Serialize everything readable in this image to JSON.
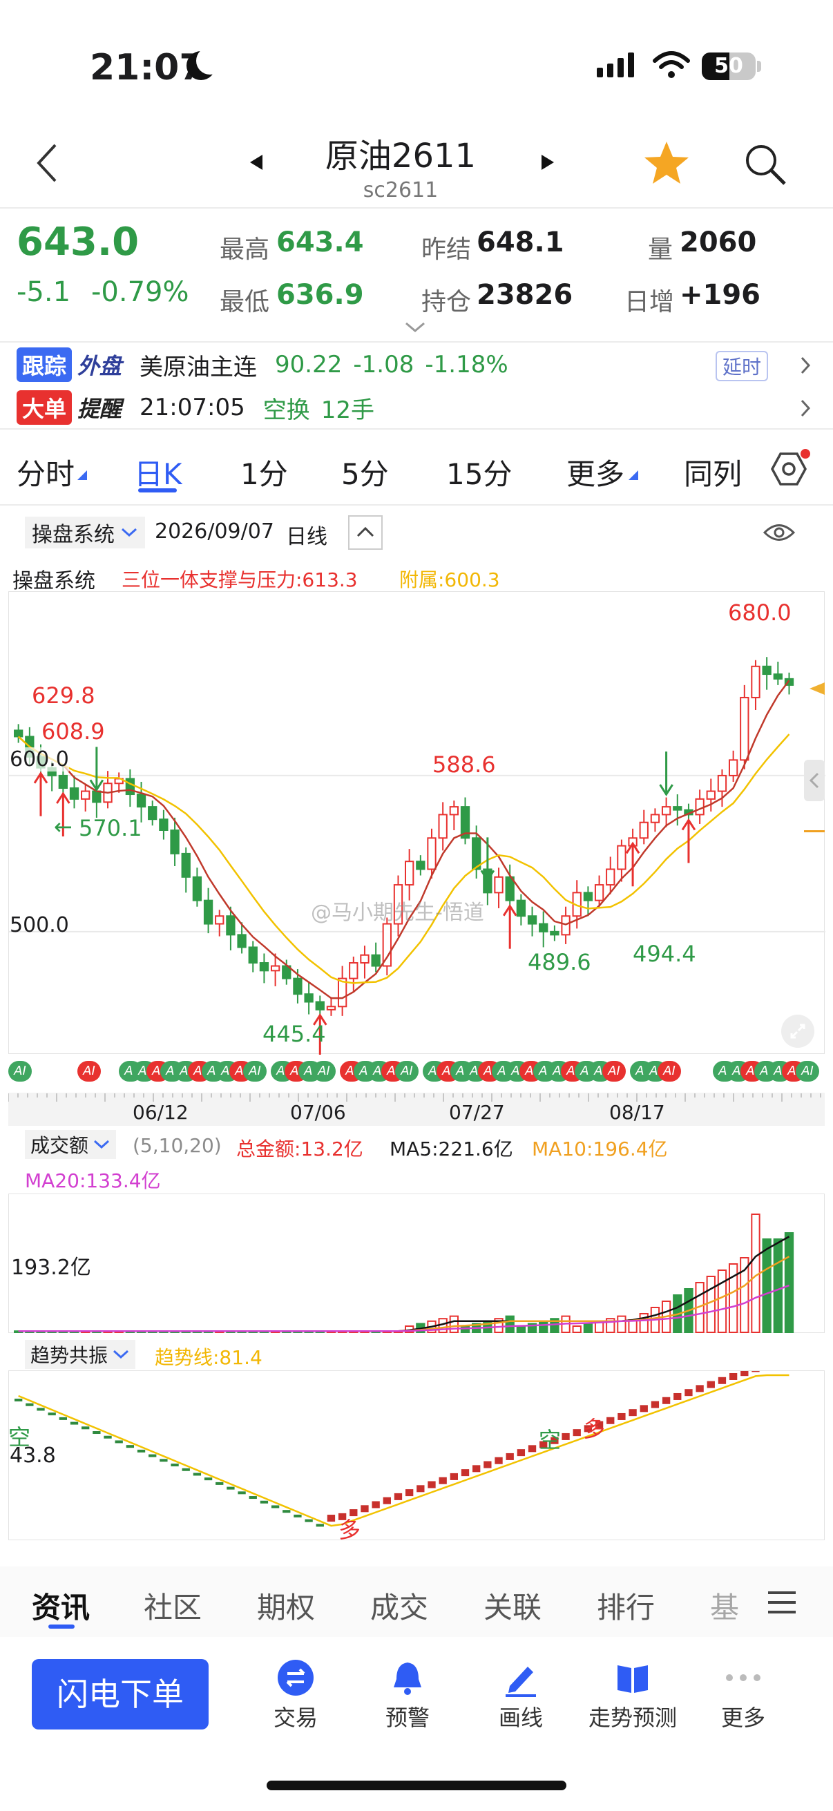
{
  "status_bar": {
    "time": "21:07",
    "battery": "50"
  },
  "header": {
    "title": "原油2611",
    "code": "sc2611"
  },
  "quote": {
    "price": "643.0",
    "change": "-5.1",
    "change_pct": "-0.79%",
    "high_label": "最高",
    "high": "643.4",
    "low_label": "最低",
    "low": "636.9",
    "prev_settle_label": "昨结",
    "prev_settle": "648.1",
    "open_interest_label": "持仓",
    "open_interest": "23826",
    "volume_label": "量",
    "volume": "2060",
    "daily_inc_label": "日增",
    "daily_inc": "+196"
  },
  "tracking": {
    "tag1": "跟踪",
    "tag2": "外盘",
    "name": "美原油主连",
    "price": "90.22",
    "change": "-1.08",
    "change_pct": "-1.18%",
    "delay": "延时"
  },
  "bigorder": {
    "tag1": "大单",
    "tag2": "提醒",
    "time": "21:07:05",
    "type": "空换",
    "size": "12手"
  },
  "tabs": [
    "分时",
    "日K",
    "1分",
    "5分",
    "15分",
    "更多",
    "同列"
  ],
  "active_tab": "日K",
  "toolbar": {
    "system": "操盘系统",
    "date": "2026/09/07",
    "period": "日线"
  },
  "main_indicator": {
    "name": "操盘系统",
    "support_label": "三位一体支撑与压力:613.3",
    "aux_label": "附属:600.3"
  },
  "price_labels": {
    "top": "680.0",
    "p1": "629.8",
    "p2": "608.9",
    "p3": "570.1",
    "p4": "588.6",
    "p5": "445.4",
    "p6": "489.6",
    "p7": "494.4",
    "y600": "600.0",
    "y500": "500.0"
  },
  "ai_marker": "AI",
  "watermark": "@马小期先生-悟道",
  "x_dates": [
    "06/12",
    "07/06",
    "07/27",
    "08/17"
  ],
  "volume_panel": {
    "name": "成交额",
    "params": "(5,10,20)",
    "total": "总金额:13.2亿",
    "ma5": "MA5:221.6亿",
    "ma10": "MA10:196.4亿",
    "ma20": "MA20:133.4亿",
    "ylabel": "193.2亿"
  },
  "trend_panel": {
    "name": "趋势共振",
    "line": "趋势线:81.4",
    "ylabel": "43.8",
    "markers": [
      "空",
      "多",
      "空",
      "多"
    ]
  },
  "bottom_tabs": [
    "资讯",
    "社区",
    "期权",
    "成交",
    "关联",
    "排行",
    "基"
  ],
  "dock": {
    "order_button": "闪电下单",
    "items": [
      "交易",
      "预警",
      "画线",
      "走势预测",
      "更多"
    ]
  },
  "colors": {
    "up": "#e8312f",
    "down": "#2f9a47",
    "accent": "#2f5cf4",
    "ma_yellow": "#f2b705",
    "ma_red": "#c0392b"
  },
  "chart_data": {
    "type": "candlestick",
    "period": "日线",
    "ylim": [
      430,
      700
    ],
    "labeled_levels": {
      "high": 680.0,
      "low": 445.4,
      "local_high": 588.6,
      "local_lows": [
        489.6,
        494.4
      ]
    },
    "x_ticks": [
      "06/12",
      "07/06",
      "07/27",
      "08/17"
    ],
    "closes": [
      625,
      612,
      605,
      600,
      592,
      585,
      590,
      583,
      595,
      598,
      588,
      580,
      572,
      565,
      550,
      535,
      520,
      505,
      510,
      498,
      490,
      480,
      475,
      478,
      470,
      460,
      455,
      450,
      452,
      470,
      480,
      485,
      478,
      505,
      530,
      545,
      540,
      560,
      575,
      580,
      560,
      540,
      525,
      535,
      520,
      510,
      505,
      500,
      498,
      510,
      525,
      520,
      530,
      540,
      555,
      560,
      570,
      575,
      580,
      578,
      575,
      585,
      590,
      600,
      610,
      650,
      670,
      665,
      662,
      658
    ]
  }
}
